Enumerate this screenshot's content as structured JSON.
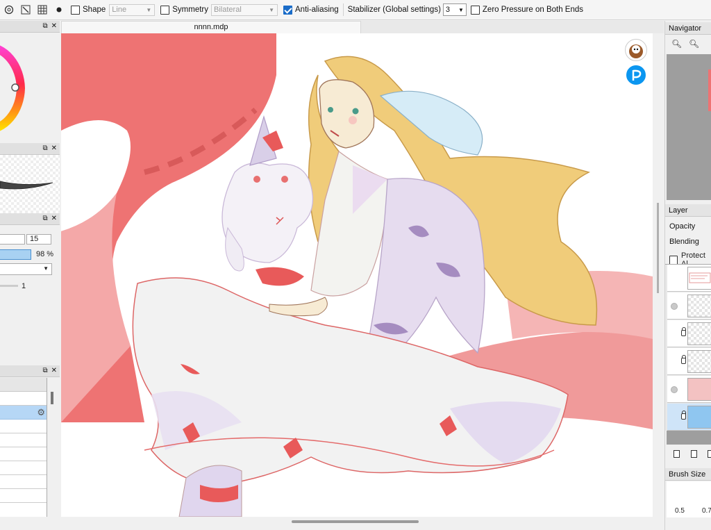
{
  "toolbar": {
    "shape_label": "Shape",
    "shape_value": "Line",
    "symmetry_label": "Symmetry",
    "symmetry_value": "Bilateral",
    "antialias_label": "Anti-aliasing",
    "stabilizer_label": "Stabilizer (Global settings)",
    "stabilizer_value": "3",
    "zero_pressure_label": "Zero Pressure on Both Ends"
  },
  "document": {
    "tab_title": "nnnn.mdp"
  },
  "left": {
    "brush_size_value": "15",
    "opacity_value": "98 %",
    "slider_value": "1"
  },
  "navigator": {
    "title": "Navigator"
  },
  "layer_panel": {
    "title": "Layer",
    "opacity_label": "Opacity",
    "blending_label": "Blending",
    "protect_alpha_label": "Protect Al"
  },
  "brush_size_panel": {
    "title": "Brush Size",
    "values": [
      "0.5",
      "0.7"
    ]
  },
  "colors": {
    "accent": "#1a6cc8",
    "canvas_red": "#ee7373",
    "hair": "#f0cc7a"
  }
}
